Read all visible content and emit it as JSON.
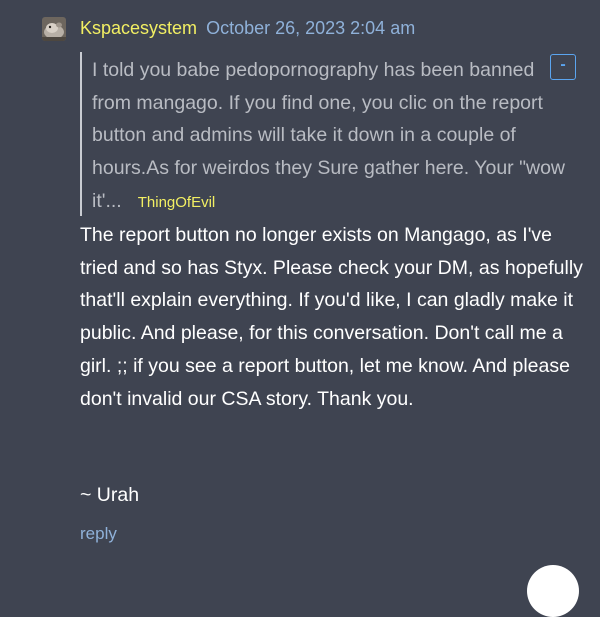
{
  "comment": {
    "avatar_icon": "animal-avatar-icon",
    "username": "Kspacesystem",
    "timestamp": "October 26, 2023 2:04 am",
    "quote": {
      "text": "I told you babe pedopornography has been banned from mangago. If you find one, you clic on the report button and admins will take it down in a couple of hours.As for weirdos they Sure gather here. Your \"wow it'...",
      "author": "ThingOfEvil",
      "collapse_label": "-"
    },
    "body": "The report button no longer exists on Mangago, as I've tried and so has Styx. Please check your DM, as hopefully that'll explain everything. If you'd like, I can gladly make it public. And please, for this conversation. Don't call me a girl. ;; if you see a report button, let me know. And please don't invalid our CSA story. Thank you.",
    "signature": "~ Urah",
    "reply_label": "reply"
  },
  "colors": {
    "background": "#3f4451",
    "username": "#f2ef63",
    "timestamp": "#8fb1d9",
    "quote_text": "#b9bcc3",
    "body_text": "#ffffff",
    "accent": "#5ba5f0"
  }
}
